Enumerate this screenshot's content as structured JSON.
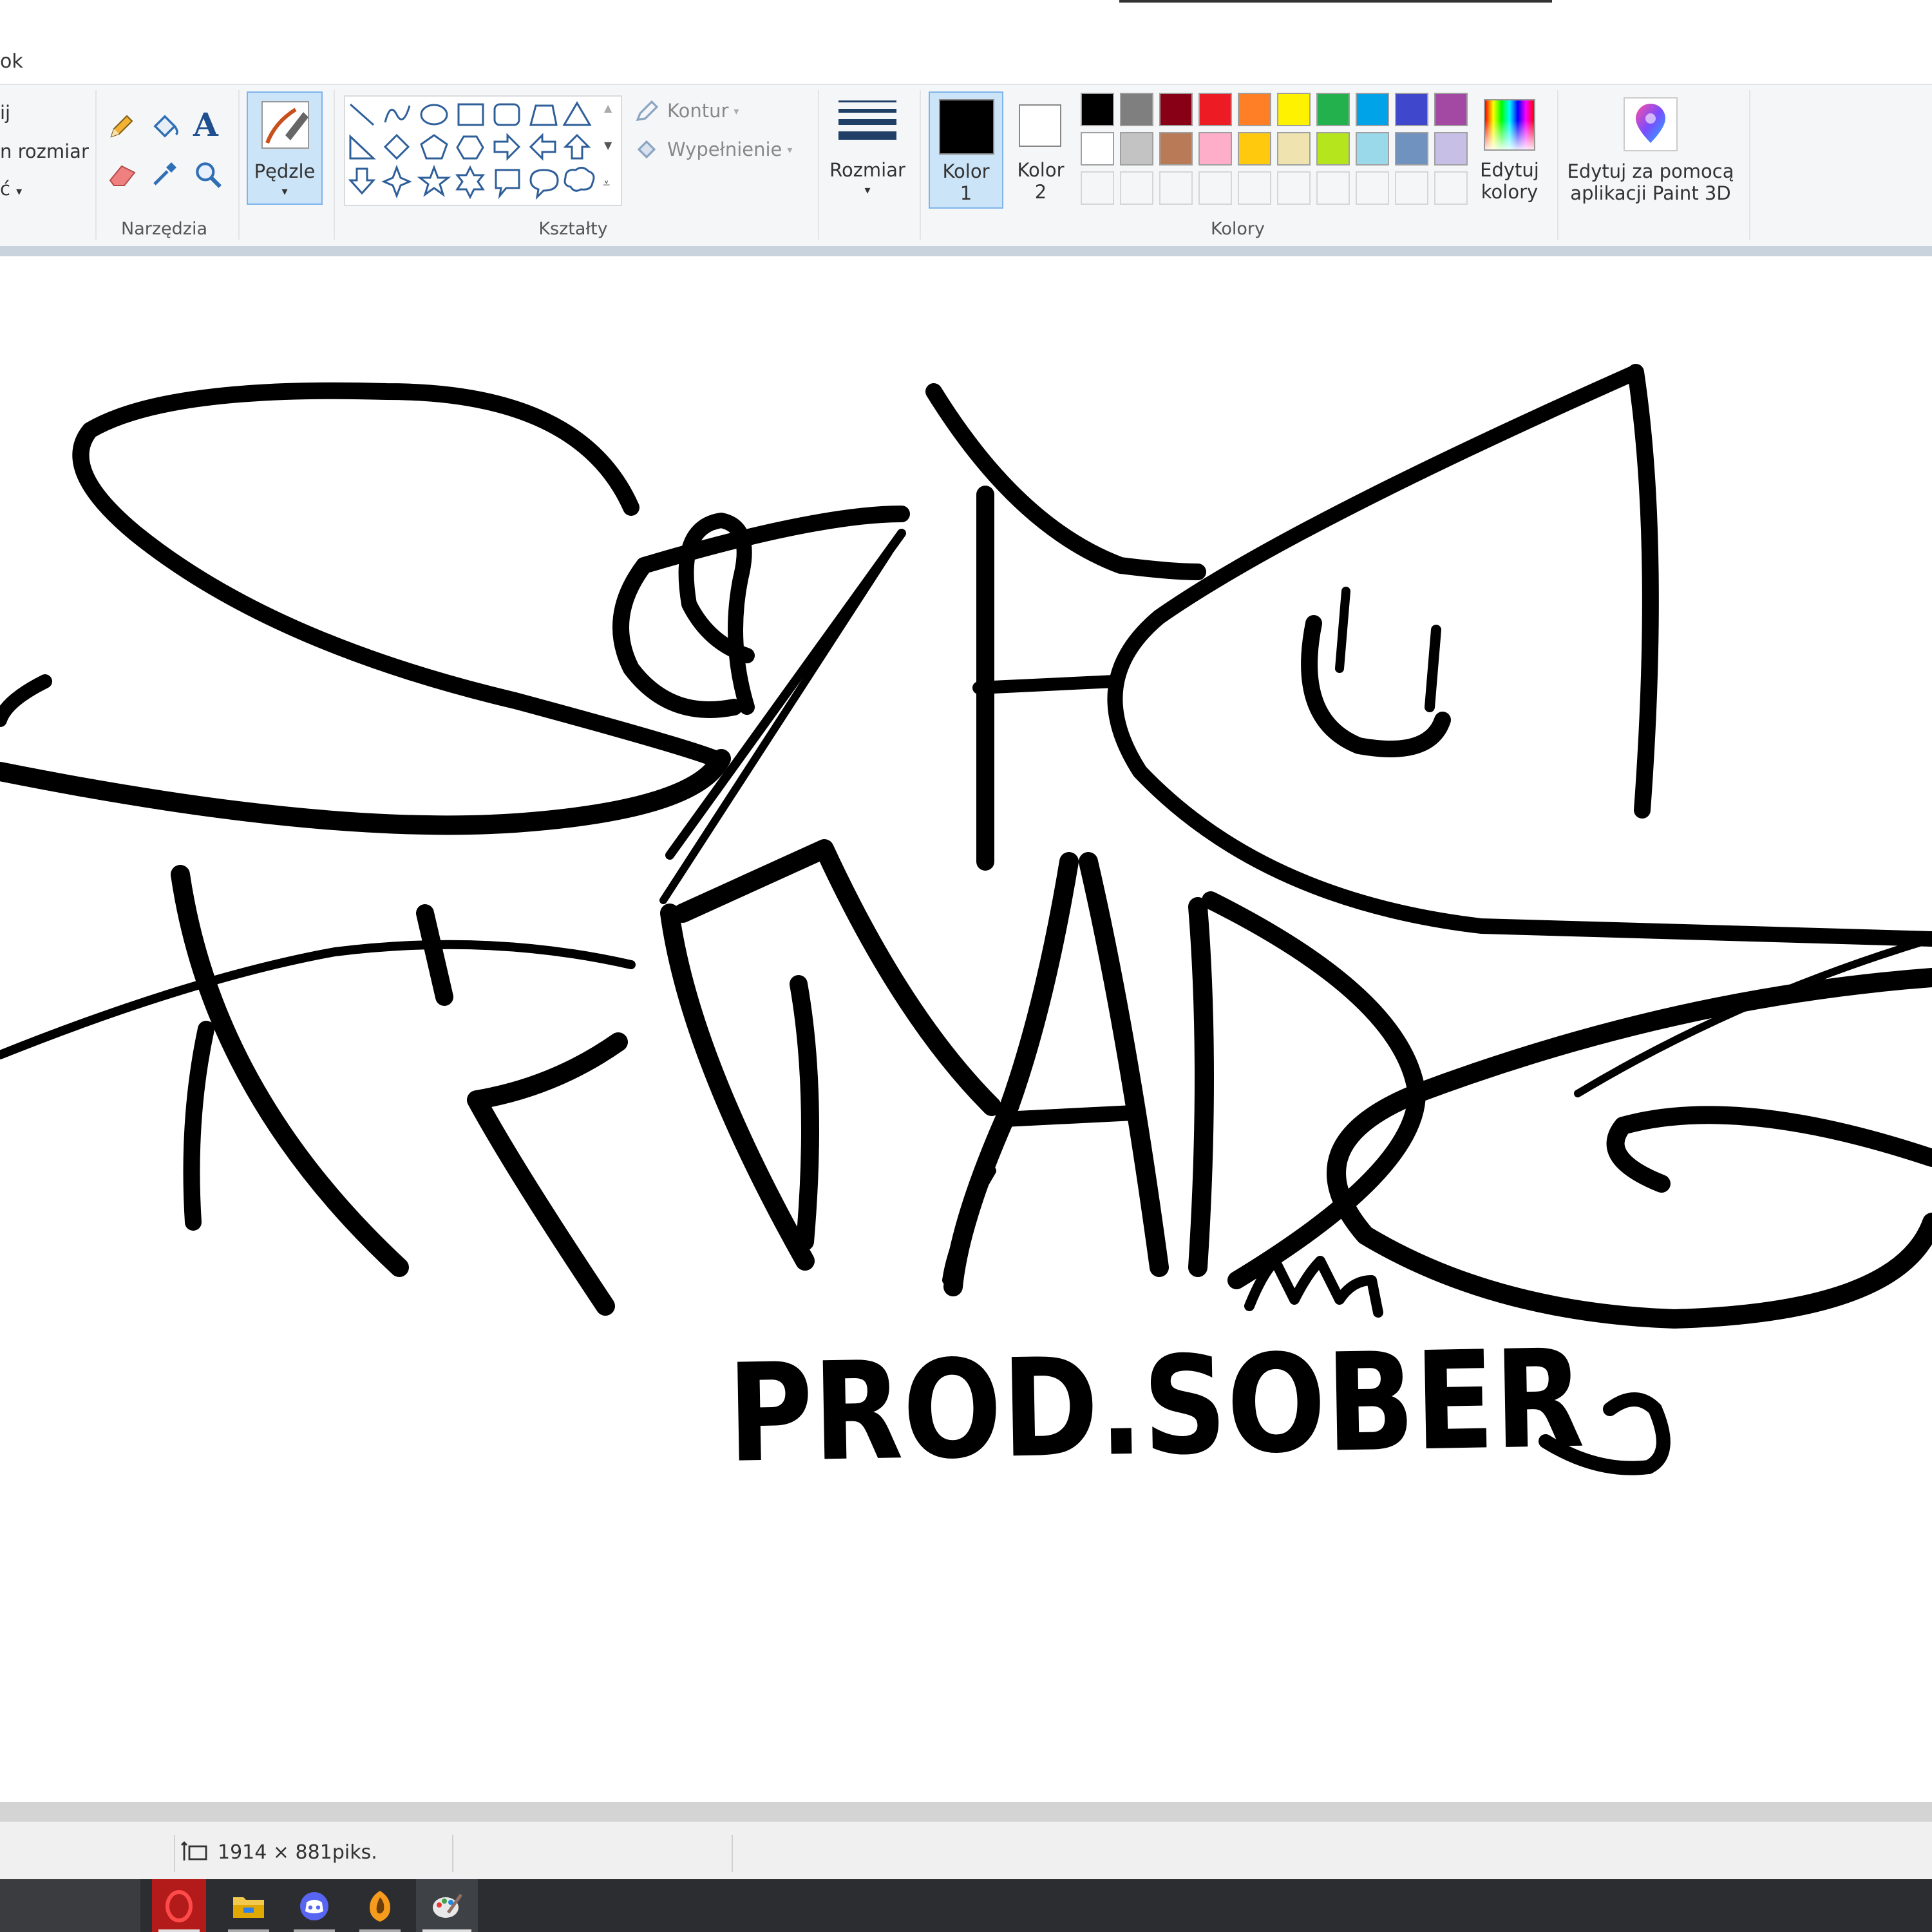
{
  "menu": {
    "partial_tab": "ok"
  },
  "left_partial": {
    "item1": "ij",
    "item2": "rozmiar",
    "item3": "ć"
  },
  "tools": {
    "group_label": "Narzędzia",
    "icons": [
      "pencil-icon",
      "fill-bucket-icon",
      "text-icon",
      "eraser-icon",
      "color-picker-icon",
      "magnifier-icon"
    ]
  },
  "brushes": {
    "label": "Pędzle"
  },
  "shapes": {
    "group_label": "Kształty",
    "outline_label": "Kontur",
    "fill_label": "Wypełnienie"
  },
  "size": {
    "label": "Rozmiar"
  },
  "colors": {
    "group_label": "Kolory",
    "color1_label_line1": "Kolor",
    "color1_label_line2": "1",
    "color1_value": "#000000",
    "color2_label_line1": "Kolor",
    "color2_label_line2": "2",
    "color2_value": "#ffffff",
    "edit_colors_line1": "Edytuj",
    "edit_colors_line2": "kolory",
    "palette_row1": [
      "#000000",
      "#7f7f7f",
      "#880015",
      "#ed1c24",
      "#ff7f27",
      "#fff200",
      "#22b14c",
      "#00a2e8",
      "#3f48cc",
      "#a349a4"
    ],
    "palette_row2": [
      "#ffffff",
      "#c3c3c3",
      "#b97a57",
      "#ffaec9",
      "#ffc90e",
      "#efe4b0",
      "#b5e61d",
      "#99d9ea",
      "#7092be",
      "#c8bfe7"
    ]
  },
  "paint3d": {
    "line1": "Edytuj za pomocą",
    "line2": "aplikacji Paint 3D"
  },
  "canvas": {
    "drawing_text": "PROD.SOBER"
  },
  "status": {
    "dimensions": "1914 × 881piks."
  },
  "taskbar": {
    "apps": [
      "opera-icon",
      "file-explorer-icon",
      "discord-icon",
      "fl-studio-icon",
      "paint-icon"
    ]
  }
}
